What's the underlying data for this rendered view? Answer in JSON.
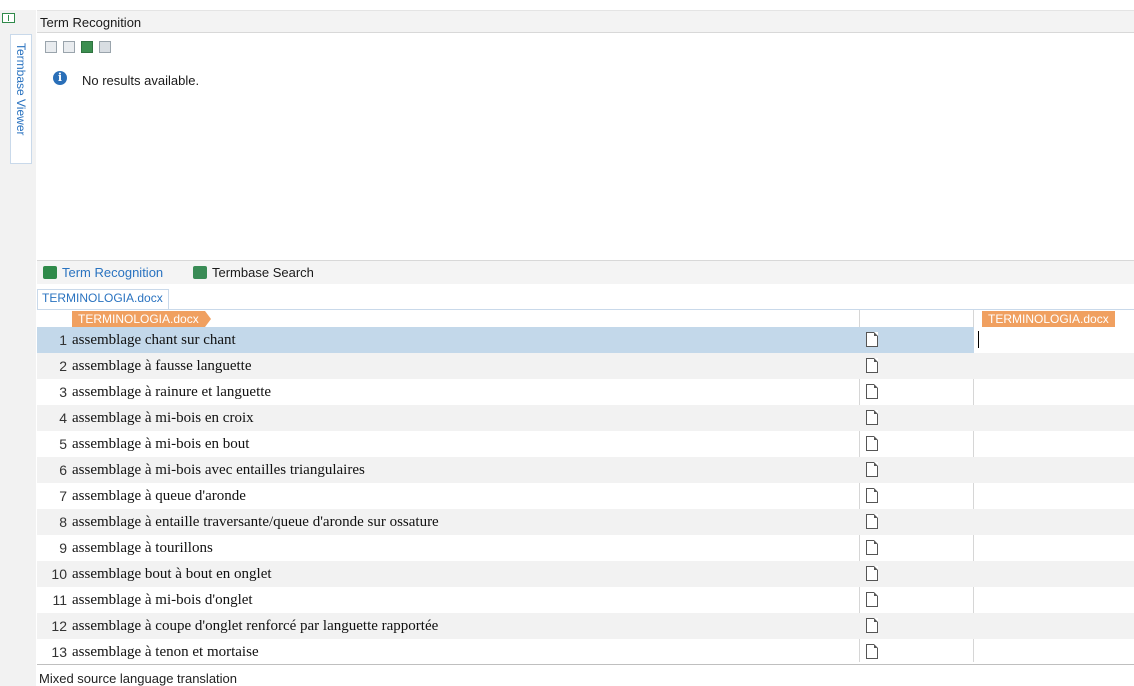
{
  "side_panel": {
    "termbase_viewer_label": "Termbase Viewer"
  },
  "term_recognition": {
    "title": "Term Recognition",
    "message": "No results available."
  },
  "panel_tabs": [
    {
      "label": "Term Recognition",
      "icon": "term-recognition-icon",
      "active": true
    },
    {
      "label": "Termbase Search",
      "icon": "termbase-search-icon",
      "active": false
    }
  ],
  "editor": {
    "document_tab": "TERMINOLOGIA.docx",
    "source_file_tag": "TERMINOLOGIA.docx",
    "target_file_tag": "TERMINOLOGIA.docx",
    "selected_row": 1,
    "segments": [
      {
        "num": "1",
        "source": "assemblage chant sur chant"
      },
      {
        "num": "2",
        "source": "assemblage à fausse languette"
      },
      {
        "num": "3",
        "source": "assemblage à rainure et languette"
      },
      {
        "num": "4",
        "source": "assemblage à mi-bois en croix"
      },
      {
        "num": "5",
        "source": "assemblage à mi-bois en bout"
      },
      {
        "num": "6",
        "source": "assemblage à mi-bois avec entailles triangulaires"
      },
      {
        "num": "7",
        "source": "assemblage à queue d'aronde"
      },
      {
        "num": "8",
        "source": "assemblage à entaille traversante/queue d'aronde sur ossature"
      },
      {
        "num": "9",
        "source": "assemblage à tourillons"
      },
      {
        "num": "10",
        "source": "assemblage bout à bout en onglet"
      },
      {
        "num": "11",
        "source": "assemblage à mi-bois d'onglet"
      },
      {
        "num": "12",
        "source": "assemblage à coupe d'onglet renforcé par languette rapportée"
      },
      {
        "num": "13",
        "source": "assemblage à tenon et mortaise"
      }
    ]
  },
  "status_bar": {
    "text": "Mixed source language translation"
  },
  "colors": {
    "accent_blue": "#2a73c0",
    "file_tag_orange": "#f0a060",
    "selected_row": "#c3d8ea",
    "alt_row": "#f2f2f2"
  }
}
